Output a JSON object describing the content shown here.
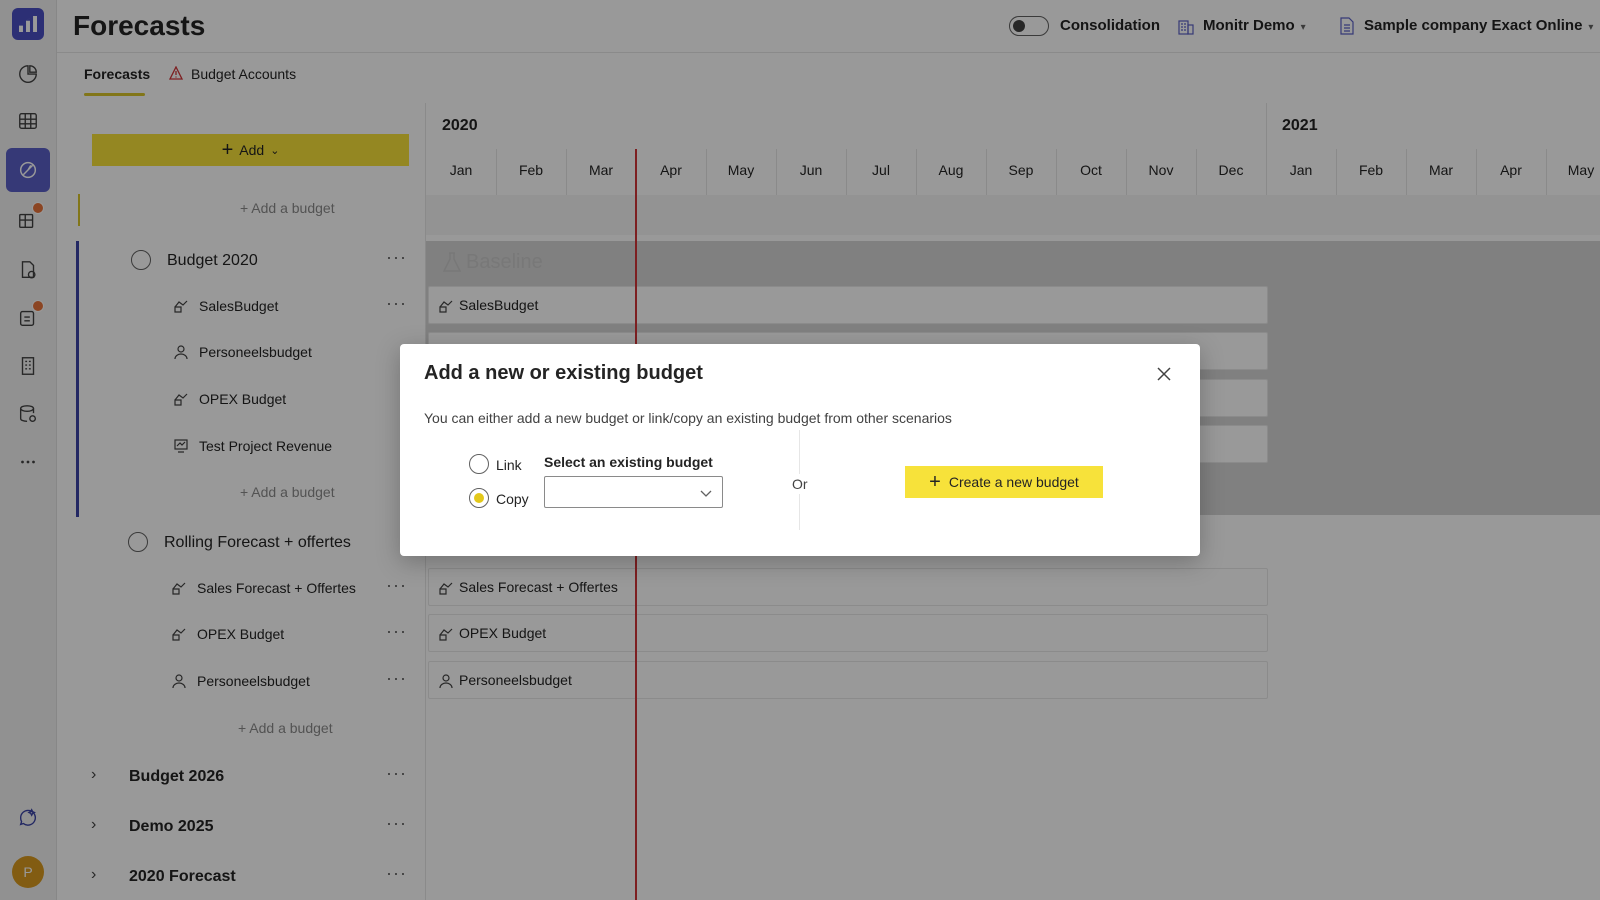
{
  "header": {
    "title": "Forecasts",
    "consolidation_label": "Consolidation",
    "org_label": "Monitr Demo",
    "company_label": "Sample company Exact Online",
    "avatar_initial": "P"
  },
  "tabs": [
    {
      "label": "Forecasts",
      "active": true
    },
    {
      "label": "Budget Accounts",
      "active": false,
      "icon": "warning-icon"
    }
  ],
  "tree": {
    "add_button_label": "Add",
    "add_budget_label": "Add a budget",
    "groups": [
      {
        "name": "Budget 2020",
        "items": [
          {
            "name": "SalesBudget",
            "icon": "sales-icon"
          },
          {
            "name": "Personeelsbudget",
            "icon": "person-icon"
          },
          {
            "name": "OPEX Budget",
            "icon": "sales-icon"
          },
          {
            "name": "Test Project Revenue",
            "icon": "project-icon"
          }
        ]
      },
      {
        "name": "Rolling Forecast + offertes",
        "items": [
          {
            "name": "Sales Forecast + Offertes",
            "icon": "sales-icon"
          },
          {
            "name": "OPEX Budget",
            "icon": "sales-icon"
          },
          {
            "name": "Personeelsbudget",
            "icon": "person-icon"
          }
        ]
      }
    ],
    "collapsed_groups": [
      "Budget 2026",
      "Demo 2025",
      "2020 Forecast"
    ]
  },
  "timeline": {
    "years": [
      "2020",
      "2021"
    ],
    "months": [
      "Jan",
      "Feb",
      "Mar",
      "Apr",
      "May",
      "Jun",
      "Jul",
      "Aug",
      "Sep",
      "Oct",
      "Nov",
      "Dec",
      "Jan",
      "Feb",
      "Mar",
      "Apr",
      "May"
    ],
    "baseline_label": "Baseline",
    "bars": [
      {
        "label": "SalesBudget"
      },
      {
        "label": "Sales Forecast + Offertes"
      },
      {
        "label": "OPEX Budget"
      },
      {
        "label": "Personeelsbudget"
      }
    ]
  },
  "dialog": {
    "title": "Add a new or existing budget",
    "description": "You can either add a new budget or link/copy an existing budget from other scenarios",
    "radio_link": "Link",
    "radio_copy": "Copy",
    "select_label": "Select an existing budget",
    "select_value": "",
    "or_label": "Or",
    "create_button_label": "Create a new budget"
  },
  "colors": {
    "accent_yellow": "#f7e23a",
    "rail_active": "#5b5fc7",
    "today_line": "#d13438",
    "badge": "#e8743b"
  }
}
